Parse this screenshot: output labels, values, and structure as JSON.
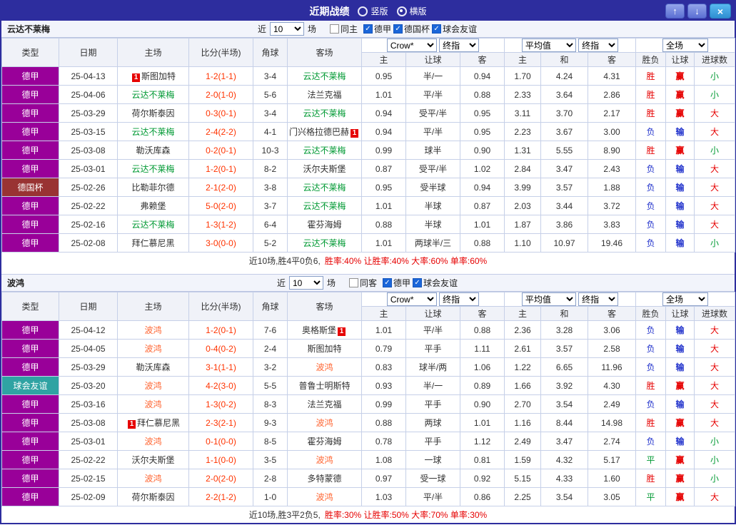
{
  "titlebar": {
    "title": "近期战绩",
    "radio_vertical": "竖版",
    "radio_horizontal": "横版",
    "up_icon": "↑",
    "down_icon": "↓",
    "close_icon": "×"
  },
  "icons": {
    "check": "✓"
  },
  "dropdowns": {
    "provider": "Crow*",
    "final": "终指",
    "average": "平均值",
    "full": "全场"
  },
  "table_headers": {
    "type": "类型",
    "date": "日期",
    "home": "主场",
    "score": "比分(半场)",
    "corner": "角球",
    "away": "客场",
    "h": "主",
    "handicap": "让球",
    "a": "客",
    "avg_h": "主",
    "avg_d": "和",
    "avg_a": "客",
    "wl": "胜负",
    "wl_handicap": "让球",
    "goals": "进球数"
  },
  "league_colors": {
    "德甲": "#990099",
    "德国杯": "#993333",
    "球会友谊": "#2fa3a3"
  },
  "result_colors": {
    "胜": "#e60000",
    "负": "#2233cc",
    "平": "#009933",
    "赢": "#e60000",
    "输": "#2233cc",
    "大": "#e60000",
    "小": "#009933"
  },
  "text_colors": {
    "score": "#ff3300"
  },
  "sections": [
    {
      "team": "云达不莱梅",
      "focus_color": "#009933",
      "filter": {
        "near": "近",
        "count": "10",
        "games": "场",
        "same": "同主",
        "leagues": [
          "德甲",
          "德国杯",
          "球会友谊"
        ]
      },
      "rows": [
        {
          "type": "德甲",
          "date": "25-04-13",
          "home": "斯图加特",
          "home_focus": false,
          "home_card": "1",
          "home_card_pos": "pre",
          "score": "1-2(1-1)",
          "corner": "3-4",
          "away": "云达不莱梅",
          "away_focus": true,
          "odds": [
            "0.95",
            "半/一",
            "0.94"
          ],
          "avg": [
            "1.70",
            "4.24",
            "4.31"
          ],
          "res": [
            "胜",
            "赢",
            "小"
          ]
        },
        {
          "type": "德甲",
          "date": "25-04-06",
          "home": "云达不莱梅",
          "home_focus": true,
          "score": "2-0(1-0)",
          "corner": "5-6",
          "away": "法兰克福",
          "away_focus": false,
          "odds": [
            "1.01",
            "平/半",
            "0.88"
          ],
          "avg": [
            "2.33",
            "3.64",
            "2.86"
          ],
          "res": [
            "胜",
            "赢",
            "小"
          ]
        },
        {
          "type": "德甲",
          "date": "25-03-29",
          "home": "荷尔斯泰因",
          "home_focus": false,
          "score": "0-3(0-1)",
          "corner": "3-4",
          "away": "云达不莱梅",
          "away_focus": true,
          "odds": [
            "0.94",
            "受平/半",
            "0.95"
          ],
          "avg": [
            "3.11",
            "3.70",
            "2.17"
          ],
          "res": [
            "胜",
            "赢",
            "大"
          ]
        },
        {
          "type": "德甲",
          "date": "25-03-15",
          "home": "云达不莱梅",
          "home_focus": true,
          "score": "2-4(2-2)",
          "corner": "4-1",
          "away": "门兴格拉德巴赫",
          "away_focus": false,
          "away_card": "1",
          "away_card_pos": "post",
          "odds": [
            "0.94",
            "平/半",
            "0.95"
          ],
          "avg": [
            "2.23",
            "3.67",
            "3.00"
          ],
          "res": [
            "负",
            "输",
            "大"
          ]
        },
        {
          "type": "德甲",
          "date": "25-03-08",
          "home": "勒沃库森",
          "home_focus": false,
          "score": "0-2(0-1)",
          "corner": "10-3",
          "away": "云达不莱梅",
          "away_focus": true,
          "odds": [
            "0.99",
            "球半",
            "0.90"
          ],
          "avg": [
            "1.31",
            "5.55",
            "8.90"
          ],
          "res": [
            "胜",
            "赢",
            "小"
          ]
        },
        {
          "type": "德甲",
          "date": "25-03-01",
          "home": "云达不莱梅",
          "home_focus": true,
          "score": "1-2(0-1)",
          "corner": "8-2",
          "away": "沃尔夫斯堡",
          "away_focus": false,
          "odds": [
            "0.87",
            "受平/半",
            "1.02"
          ],
          "avg": [
            "2.84",
            "3.47",
            "2.43"
          ],
          "res": [
            "负",
            "输",
            "大"
          ]
        },
        {
          "type": "德国杯",
          "date": "25-02-26",
          "home": "比勒菲尔德",
          "home_focus": false,
          "score": "2-1(2-0)",
          "corner": "3-8",
          "away": "云达不莱梅",
          "away_focus": true,
          "odds": [
            "0.95",
            "受半球",
            "0.94"
          ],
          "avg": [
            "3.99",
            "3.57",
            "1.88"
          ],
          "res": [
            "负",
            "输",
            "大"
          ]
        },
        {
          "type": "德甲",
          "date": "25-02-22",
          "home": "弗赖堡",
          "home_focus": false,
          "score": "5-0(2-0)",
          "corner": "3-7",
          "away": "云达不莱梅",
          "away_focus": true,
          "odds": [
            "1.01",
            "半球",
            "0.87"
          ],
          "avg": [
            "2.03",
            "3.44",
            "3.72"
          ],
          "res": [
            "负",
            "输",
            "大"
          ]
        },
        {
          "type": "德甲",
          "date": "25-02-16",
          "home": "云达不莱梅",
          "home_focus": true,
          "score": "1-3(1-2)",
          "corner": "6-4",
          "away": "霍芬海姆",
          "away_focus": false,
          "odds": [
            "0.88",
            "半球",
            "1.01"
          ],
          "avg": [
            "1.87",
            "3.86",
            "3.83"
          ],
          "res": [
            "负",
            "输",
            "大"
          ]
        },
        {
          "type": "德甲",
          "date": "25-02-08",
          "home": "拜仁慕尼黑",
          "home_focus": false,
          "score": "3-0(0-0)",
          "corner": "5-2",
          "away": "云达不莱梅",
          "away_focus": true,
          "odds": [
            "1.01",
            "两球半/三",
            "0.88"
          ],
          "avg": [
            "1.10",
            "10.97",
            "19.46"
          ],
          "res": [
            "负",
            "输",
            "小"
          ]
        }
      ],
      "summary": {
        "record": "近10场,胜4平0负6,",
        "rates": "胜率:40% 让胜率:40% 大率:60% 单率:60%"
      }
    },
    {
      "team": "波鸿",
      "focus_color": "#ff6633",
      "filter": {
        "near": "近",
        "count": "10",
        "games": "场",
        "same": "同客",
        "leagues": [
          "德甲",
          "球会友谊"
        ]
      },
      "rows": [
        {
          "type": "德甲",
          "date": "25-04-12",
          "home": "波鸿",
          "home_focus": true,
          "score": "1-2(0-1)",
          "corner": "7-6",
          "away": "奥格斯堡",
          "away_focus": false,
          "away_card": "1",
          "away_card_pos": "post",
          "odds": [
            "1.01",
            "平/半",
            "0.88"
          ],
          "avg": [
            "2.36",
            "3.28",
            "3.06"
          ],
          "res": [
            "负",
            "输",
            "大"
          ]
        },
        {
          "type": "德甲",
          "date": "25-04-05",
          "home": "波鸿",
          "home_focus": true,
          "score": "0-4(0-2)",
          "corner": "2-4",
          "away": "斯图加特",
          "away_focus": false,
          "odds": [
            "0.79",
            "平手",
            "1.11"
          ],
          "avg": [
            "2.61",
            "3.57",
            "2.58"
          ],
          "res": [
            "负",
            "输",
            "大"
          ]
        },
        {
          "type": "德甲",
          "date": "25-03-29",
          "home": "勒沃库森",
          "home_focus": false,
          "score": "3-1(1-1)",
          "corner": "3-2",
          "away": "波鸿",
          "away_focus": true,
          "odds": [
            "0.83",
            "球半/两",
            "1.06"
          ],
          "avg": [
            "1.22",
            "6.65",
            "11.96"
          ],
          "res": [
            "负",
            "输",
            "大"
          ]
        },
        {
          "type": "球会友谊",
          "date": "25-03-20",
          "home": "波鸿",
          "home_focus": true,
          "score": "4-2(3-0)",
          "corner": "5-5",
          "away": "普鲁士明斯特",
          "away_focus": false,
          "odds": [
            "0.93",
            "半/一",
            "0.89"
          ],
          "avg": [
            "1.66",
            "3.92",
            "4.30"
          ],
          "res": [
            "胜",
            "赢",
            "大"
          ]
        },
        {
          "type": "德甲",
          "date": "25-03-16",
          "home": "波鸿",
          "home_focus": true,
          "score": "1-3(0-2)",
          "corner": "8-3",
          "away": "法兰克福",
          "away_focus": false,
          "odds": [
            "0.99",
            "平手",
            "0.90"
          ],
          "avg": [
            "2.70",
            "3.54",
            "2.49"
          ],
          "res": [
            "负",
            "输",
            "大"
          ]
        },
        {
          "type": "德甲",
          "date": "25-03-08",
          "home": "拜仁慕尼黑",
          "home_focus": false,
          "home_card": "1",
          "home_card_pos": "pre",
          "score": "2-3(2-1)",
          "corner": "9-3",
          "away": "波鸿",
          "away_focus": true,
          "odds": [
            "0.88",
            "两球",
            "1.01"
          ],
          "avg": [
            "1.16",
            "8.44",
            "14.98"
          ],
          "res": [
            "胜",
            "赢",
            "大"
          ]
        },
        {
          "type": "德甲",
          "date": "25-03-01",
          "home": "波鸿",
          "home_focus": true,
          "score": "0-1(0-0)",
          "corner": "8-5",
          "away": "霍芬海姆",
          "away_focus": false,
          "odds": [
            "0.78",
            "平手",
            "1.12"
          ],
          "avg": [
            "2.49",
            "3.47",
            "2.74"
          ],
          "res": [
            "负",
            "输",
            "小"
          ]
        },
        {
          "type": "德甲",
          "date": "25-02-22",
          "home": "沃尔夫斯堡",
          "home_focus": false,
          "score": "1-1(0-0)",
          "corner": "3-5",
          "away": "波鸿",
          "away_focus": true,
          "odds": [
            "1.08",
            "一球",
            "0.81"
          ],
          "avg": [
            "1.59",
            "4.32",
            "5.17"
          ],
          "res": [
            "平",
            "赢",
            "小"
          ]
        },
        {
          "type": "德甲",
          "date": "25-02-15",
          "home": "波鸿",
          "home_focus": true,
          "score": "2-0(2-0)",
          "corner": "2-8",
          "away": "多特蒙德",
          "away_focus": false,
          "odds": [
            "0.97",
            "受一球",
            "0.92"
          ],
          "avg": [
            "5.15",
            "4.33",
            "1.60"
          ],
          "res": [
            "胜",
            "赢",
            "小"
          ]
        },
        {
          "type": "德甲",
          "date": "25-02-09",
          "home": "荷尔斯泰因",
          "home_focus": false,
          "score": "2-2(1-2)",
          "corner": "1-0",
          "away": "波鸿",
          "away_focus": true,
          "odds": [
            "1.03",
            "平/半",
            "0.86"
          ],
          "avg": [
            "2.25",
            "3.54",
            "3.05"
          ],
          "res": [
            "平",
            "赢",
            "大"
          ]
        }
      ],
      "summary": {
        "record": "近10场,胜3平2负5,",
        "rates": "胜率:30% 让胜率:50% 大率:70% 单率:30%"
      }
    }
  ]
}
